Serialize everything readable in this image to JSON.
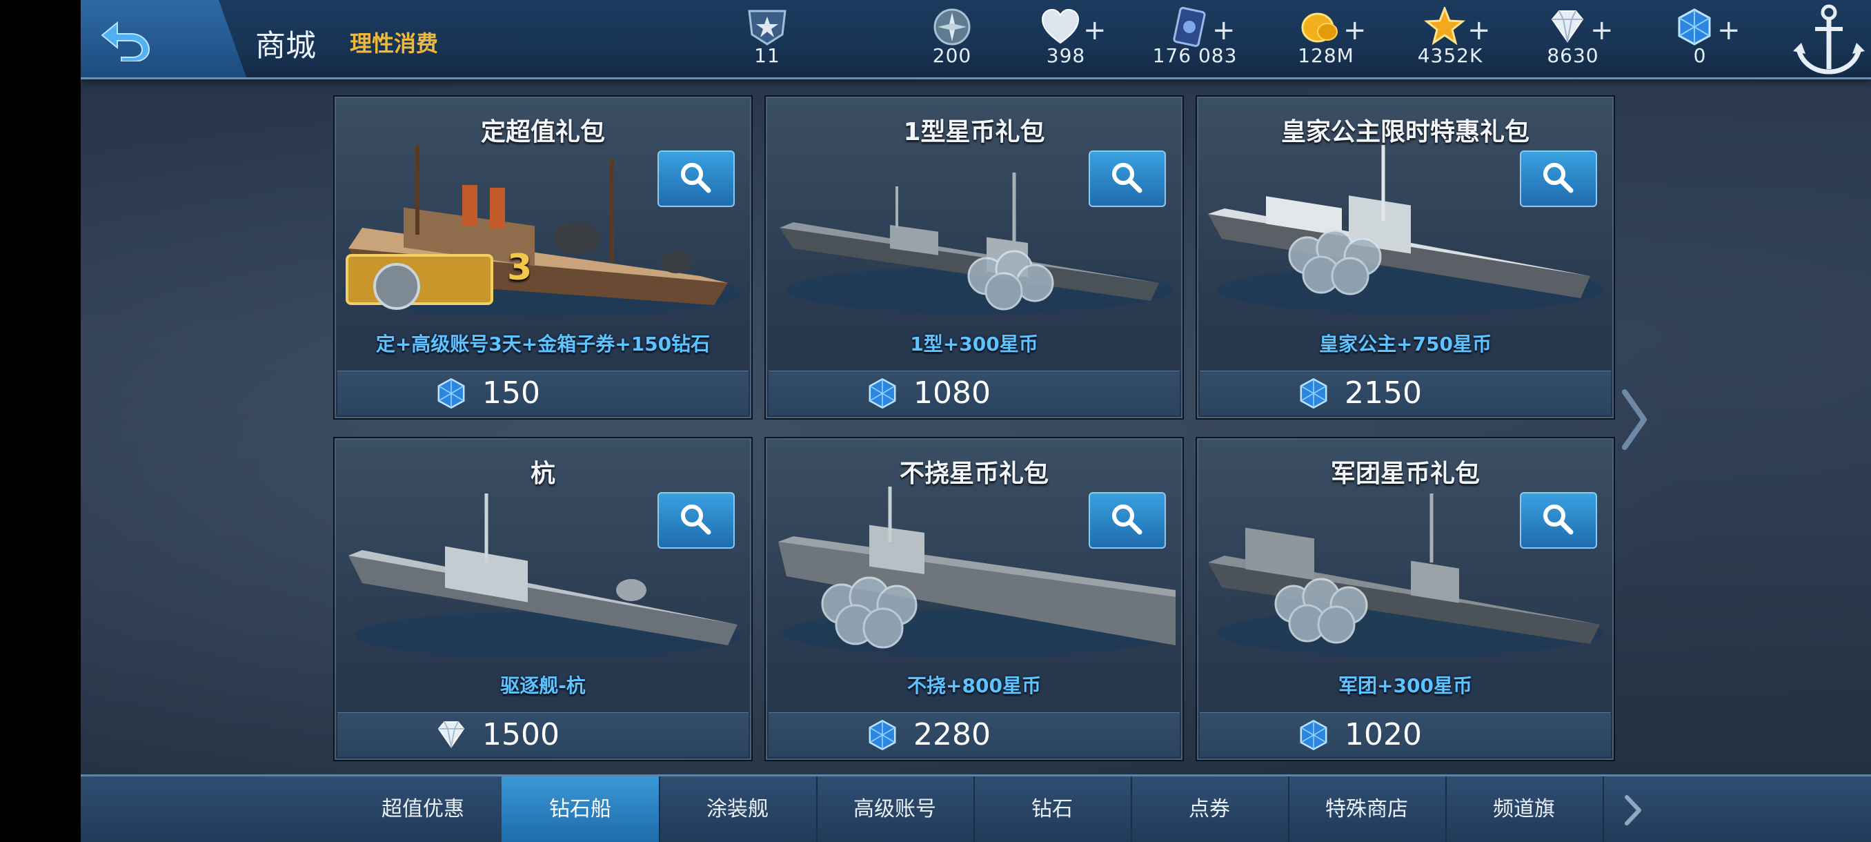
{
  "header": {
    "title": "商城",
    "subtitle": "理性消费",
    "resources": [
      {
        "name": "rank-icon",
        "value": "11",
        "has_plus": false
      },
      {
        "name": "compass-icon",
        "value": "200",
        "has_plus": false
      },
      {
        "name": "heart-icon",
        "value": "398",
        "has_plus": true
      },
      {
        "name": "card-icon",
        "value": "176 083",
        "has_plus": true
      },
      {
        "name": "gold-coin-icon",
        "value": "128M",
        "has_plus": true
      },
      {
        "name": "star-coin-icon",
        "value": "4352K",
        "has_plus": true
      },
      {
        "name": "diamond-icon",
        "value": "8630",
        "has_plus": true
      },
      {
        "name": "blue-gem-icon",
        "value": "0",
        "has_plus": true
      }
    ]
  },
  "cards": [
    {
      "title": "定超值礼包",
      "desc": "定+高级账号3天+金箱子券+150钻石",
      "price": "150",
      "currency": "blue-gem-icon",
      "badge": "3"
    },
    {
      "title": "1型星币礼包",
      "desc": "1型+300星币",
      "price": "1080",
      "currency": "blue-gem-icon"
    },
    {
      "title": "皇家公主限时特惠礼包",
      "desc": "皇家公主+750星币",
      "price": "2150",
      "currency": "blue-gem-icon"
    },
    {
      "title": "杭",
      "desc": "驱逐舰-杭",
      "price": "1500",
      "currency": "diamond-icon"
    },
    {
      "title": "不挠星币礼包",
      "desc": "不挠+800星币",
      "price": "2280",
      "currency": "blue-gem-icon"
    },
    {
      "title": "军团星币礼包",
      "desc": "军团+300星币",
      "price": "1020",
      "currency": "blue-gem-icon"
    }
  ],
  "tabs": [
    {
      "label": "超值优惠",
      "active": false
    },
    {
      "label": "钻石船",
      "active": true
    },
    {
      "label": "涂装舰",
      "active": false
    },
    {
      "label": "高级账号",
      "active": false
    },
    {
      "label": "钻石",
      "active": false
    },
    {
      "label": "点券",
      "active": false
    },
    {
      "label": "特殊商店",
      "active": false
    },
    {
      "label": "频道旗",
      "active": false
    }
  ],
  "colors": {
    "accent_blue": "#2e8fd6",
    "subtitle_gold": "#f0b83a",
    "desc_cyan": "#5ec3ff"
  }
}
